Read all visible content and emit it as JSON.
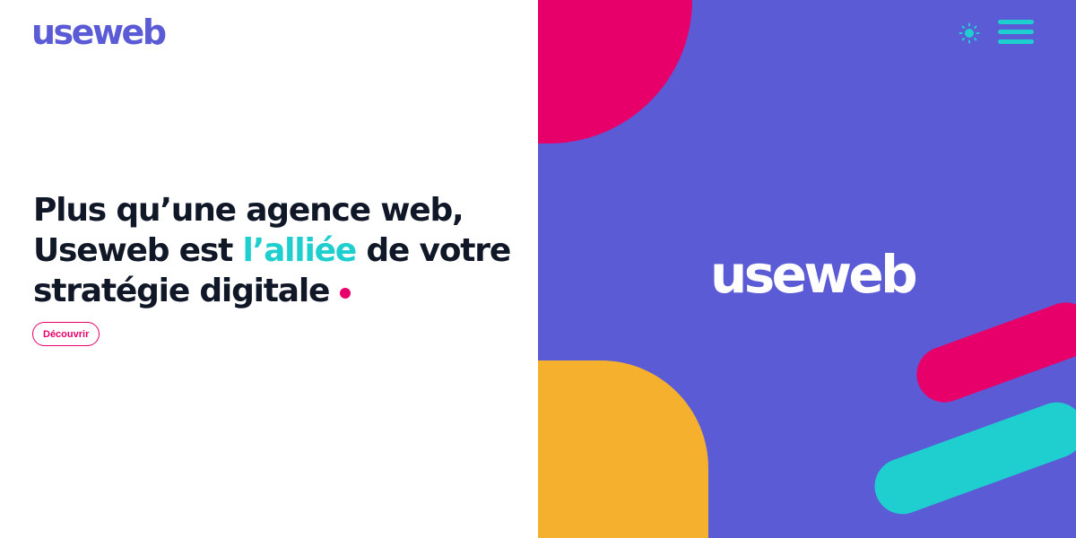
{
  "brand": {
    "name": "useweb"
  },
  "hero": {
    "headline_line1": "Plus qu’une agence web,",
    "headline_line2_start": "Useweb est ",
    "headline_line2_accent": "l’alliée",
    "headline_line2_end": " de votre",
    "headline_line3": "stratégie digitale",
    "cta_label": "Découvrir"
  },
  "header": {
    "theme_toggle_icon": "sun-icon",
    "menu_icon": "hamburger-menu-icon"
  },
  "colors": {
    "brand_purple": "#5b5bd6",
    "accent_teal": "#1fcfcf",
    "accent_pink": "#e8006a",
    "accent_yellow": "#f5b02e",
    "panel_background": "#5b5bd6",
    "text_dark": "#101828"
  }
}
